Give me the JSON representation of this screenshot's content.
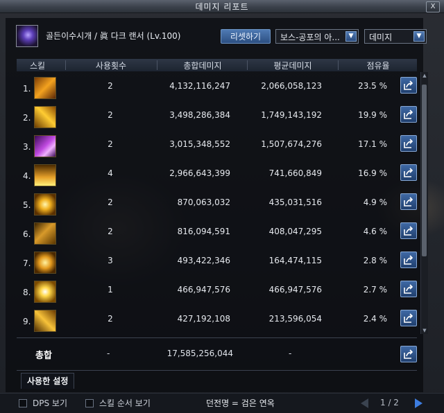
{
  "window": {
    "title": "데미지 리포트",
    "close_label": "X"
  },
  "character": {
    "name": "골든이수시개 / 眞 다크 랜서 (Lv.100)"
  },
  "controls": {
    "reset_label": "리셋하기",
    "target_select": "보스-공포의 아...",
    "metric_select": "데미지"
  },
  "table": {
    "headers": [
      "스킬",
      "사용횟수",
      "총합데미지",
      "평균데미지",
      "점유율"
    ],
    "rows": [
      {
        "rank": "1.",
        "icon": "skill-icon-1",
        "uses": "2",
        "total": "4,132,116,247",
        "avg": "2,066,058,123",
        "share": "23.5 %"
      },
      {
        "rank": "2.",
        "icon": "skill-icon-2",
        "uses": "2",
        "total": "3,498,286,384",
        "avg": "1,749,143,192",
        "share": "19.9 %"
      },
      {
        "rank": "3.",
        "icon": "skill-icon-3",
        "uses": "2",
        "total": "3,015,348,552",
        "avg": "1,507,674,276",
        "share": "17.1 %"
      },
      {
        "rank": "4.",
        "icon": "skill-icon-4",
        "uses": "4",
        "total": "2,966,643,399",
        "avg": "741,660,849",
        "share": "16.9 %"
      },
      {
        "rank": "5.",
        "icon": "skill-icon-5",
        "uses": "2",
        "total": "870,063,032",
        "avg": "435,031,516",
        "share": "4.9 %"
      },
      {
        "rank": "6.",
        "icon": "skill-icon-6",
        "uses": "2",
        "total": "816,094,591",
        "avg": "408,047,295",
        "share": "4.6 %"
      },
      {
        "rank": "7.",
        "icon": "skill-icon-7",
        "uses": "3",
        "total": "493,422,346",
        "avg": "164,474,115",
        "share": "2.8 %"
      },
      {
        "rank": "8.",
        "icon": "skill-icon-8",
        "uses": "1",
        "total": "466,947,576",
        "avg": "466,947,576",
        "share": "2.7 %"
      },
      {
        "rank": "9.",
        "icon": "skill-icon-9",
        "uses": "2",
        "total": "427,192,108",
        "avg": "213,596,054",
        "share": "2.4 %"
      }
    ],
    "total_row": {
      "label": "총합",
      "uses": "-",
      "total": "17,585,256,044",
      "avg": "-"
    }
  },
  "tabs": {
    "used_settings": "사용한 설정"
  },
  "footer": {
    "dps_label": "DPS 보기",
    "order_label": "스킬 순서 보기",
    "status_text": "던전명 = 검은 연옥",
    "page": "1 / 2"
  },
  "colors": {
    "accent": "#3d7de0",
    "panel": "#0c0f14",
    "button": "#2c4f82"
  }
}
